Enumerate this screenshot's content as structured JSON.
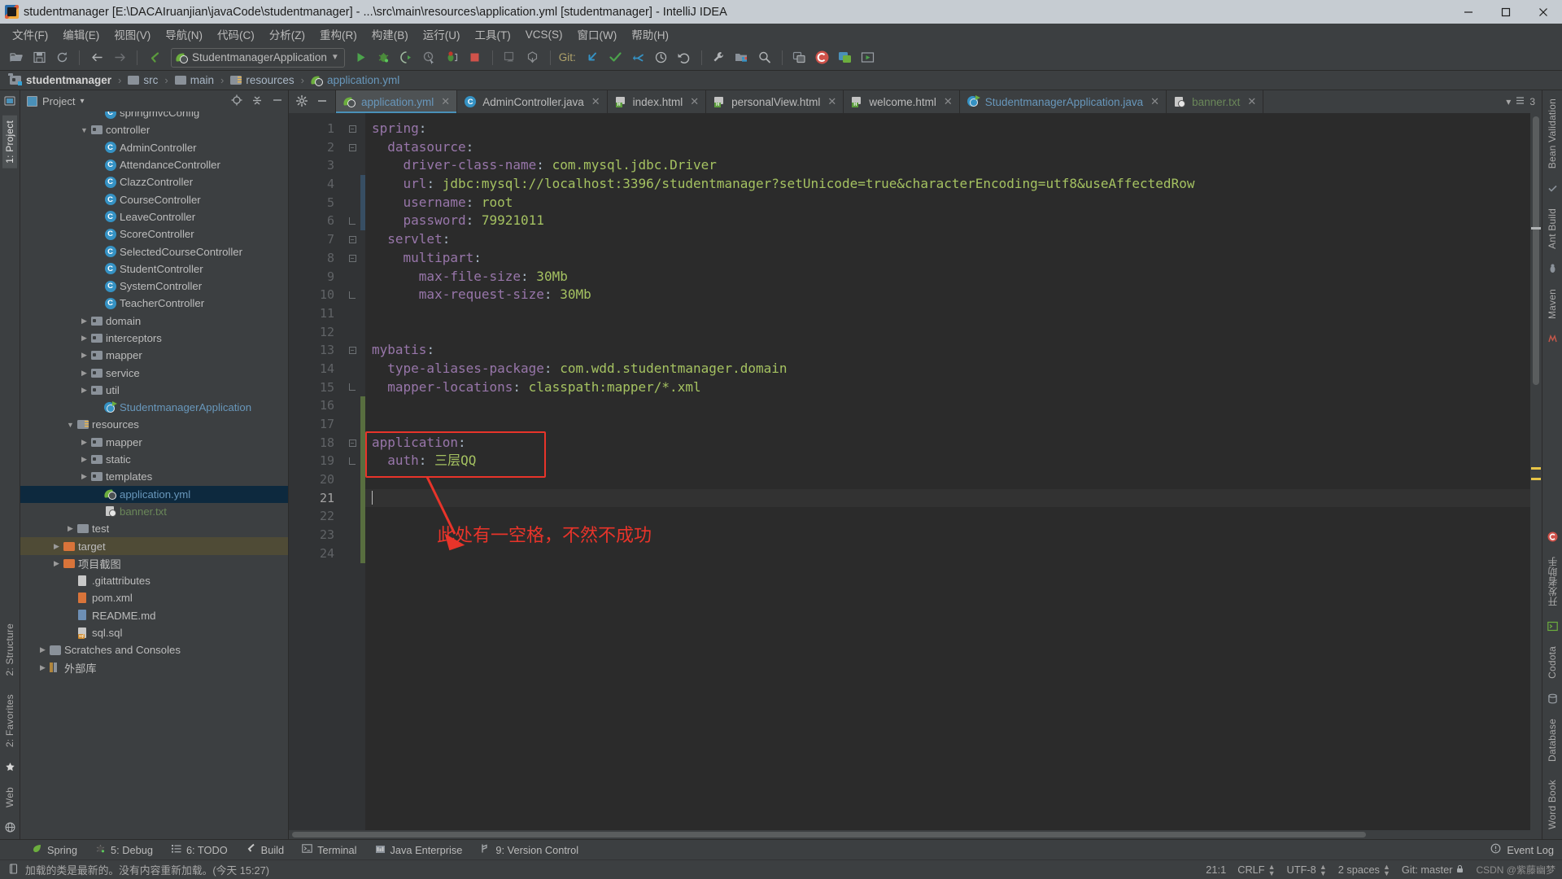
{
  "window": {
    "title": "studentmanager [E:\\DACAIruanjian\\javaCode\\studentmanager] - ...\\src\\main\\resources\\application.yml [studentmanager] - IntelliJ IDEA",
    "minimize": "—",
    "maximize": "▢",
    "close": "✕"
  },
  "menubar": {
    "items": [
      {
        "label": "文件(F)"
      },
      {
        "label": "编辑(E)"
      },
      {
        "label": "视图(V)"
      },
      {
        "label": "导航(N)"
      },
      {
        "label": "代码(C)"
      },
      {
        "label": "分析(Z)"
      },
      {
        "label": "重构(R)"
      },
      {
        "label": "构建(B)"
      },
      {
        "label": "运行(U)"
      },
      {
        "label": "工具(T)"
      },
      {
        "label": "VCS(S)"
      },
      {
        "label": "窗口(W)"
      },
      {
        "label": "帮助(H)"
      }
    ]
  },
  "toolbar": {
    "open_label": "open-folder",
    "save_label": "save-all",
    "sync_label": "synchronize",
    "back_label": "back",
    "forward_label": "forward",
    "run_configuration": "StudentmanagerApplication",
    "git_label": "Git:",
    "run_label": "Run",
    "debug_label": "Debug",
    "run_with_coverage_label": "Run with Coverage",
    "profile_label": "Profiler",
    "attach_label": "Attach Debugger",
    "stop_label": "Stop"
  },
  "navbar": {
    "crumbs": [
      {
        "label": "studentmanager",
        "kind": "module"
      },
      {
        "label": "src",
        "kind": "folder"
      },
      {
        "label": "main",
        "kind": "folder"
      },
      {
        "label": "resources",
        "kind": "resources"
      },
      {
        "label": "application.yml",
        "kind": "yml"
      }
    ],
    "separator": "›"
  },
  "left_rail": {
    "project_tab": "1: Project",
    "structure_tab": "2: Structure",
    "favorites_tab": "2: Favorites",
    "web_tab": "Web"
  },
  "right_rail": {
    "bean_validation_tab": "Bean Validation",
    "ant_build_tab": "Ant Build",
    "maven_tab": "Maven",
    "codota_tab": "Codota",
    "database_tab": "Database",
    "word_book_tab": "Word Book",
    "chinese_tab": "开发者助手"
  },
  "project_panel": {
    "title": "Project",
    "dropdown": "▾",
    "locate_icon": "crosshair-icon",
    "collapse_icon": "collapse-all-icon",
    "hide_icon": "hide-icon",
    "tree": [
      {
        "label": "springmvcConfig",
        "indent": 5,
        "icon": "class",
        "color": "white",
        "arrow": "",
        "partial": true
      },
      {
        "label": "controller",
        "indent": 4,
        "icon": "folder",
        "color": "white",
        "arrow": "▼"
      },
      {
        "label": "AdminController",
        "indent": 5,
        "icon": "class",
        "color": "white",
        "arrow": ""
      },
      {
        "label": "AttendanceController",
        "indent": 5,
        "icon": "class",
        "color": "white",
        "arrow": ""
      },
      {
        "label": "ClazzController",
        "indent": 5,
        "icon": "class",
        "color": "white",
        "arrow": ""
      },
      {
        "label": "CourseController",
        "indent": 5,
        "icon": "class",
        "color": "white",
        "arrow": ""
      },
      {
        "label": "LeaveController",
        "indent": 5,
        "icon": "class",
        "color": "white",
        "arrow": ""
      },
      {
        "label": "ScoreController",
        "indent": 5,
        "icon": "class",
        "color": "white",
        "arrow": ""
      },
      {
        "label": "SelectedCourseController",
        "indent": 5,
        "icon": "class",
        "color": "white",
        "arrow": ""
      },
      {
        "label": "StudentController",
        "indent": 5,
        "icon": "class",
        "color": "white",
        "arrow": ""
      },
      {
        "label": "SystemController",
        "indent": 5,
        "icon": "class",
        "color": "white",
        "arrow": ""
      },
      {
        "label": "TeacherController",
        "indent": 5,
        "icon": "class",
        "color": "white",
        "arrow": ""
      },
      {
        "label": "domain",
        "indent": 4,
        "icon": "folder",
        "color": "white",
        "arrow": "▶"
      },
      {
        "label": "interceptors",
        "indent": 4,
        "icon": "folder",
        "color": "white",
        "arrow": "▶"
      },
      {
        "label": "mapper",
        "indent": 4,
        "icon": "folder",
        "color": "white",
        "arrow": "▶"
      },
      {
        "label": "service",
        "indent": 4,
        "icon": "folder",
        "color": "white",
        "arrow": "▶"
      },
      {
        "label": "util",
        "indent": 4,
        "icon": "folder",
        "color": "white",
        "arrow": "▶"
      },
      {
        "label": "StudentmanagerApplication",
        "indent": 5,
        "icon": "spring",
        "color": "blue",
        "arrow": ""
      },
      {
        "label": "resources",
        "indent": 3,
        "icon": "resources",
        "color": "white",
        "arrow": "▼"
      },
      {
        "label": "mapper",
        "indent": 4,
        "icon": "folder",
        "color": "white",
        "arrow": "▶"
      },
      {
        "label": "static",
        "indent": 4,
        "icon": "folder",
        "color": "white",
        "arrow": "▶"
      },
      {
        "label": "templates",
        "indent": 4,
        "icon": "folder",
        "color": "white",
        "arrow": "▶"
      },
      {
        "label": "application.yml",
        "indent": 5,
        "icon": "yml",
        "color": "blue",
        "arrow": "",
        "selected": true
      },
      {
        "label": "banner.txt",
        "indent": 5,
        "icon": "banner",
        "color": "green",
        "arrow": ""
      },
      {
        "label": "test",
        "indent": 3,
        "icon": "folder-plain",
        "color": "white",
        "arrow": "▶"
      },
      {
        "label": "target",
        "indent": 2,
        "icon": "folder-orange",
        "color": "white",
        "arrow": "▶",
        "highlight": true
      },
      {
        "label": "项目截图",
        "indent": 2,
        "icon": "folder-orange",
        "color": "white",
        "arrow": "▶"
      },
      {
        "label": ".gitattributes",
        "indent": 3,
        "icon": "git",
        "color": "white",
        "arrow": ""
      },
      {
        "label": "pom.xml",
        "indent": 3,
        "icon": "xml",
        "color": "white",
        "arrow": ""
      },
      {
        "label": "README.md",
        "indent": 3,
        "icon": "md",
        "color": "white",
        "arrow": ""
      },
      {
        "label": "sql.sql",
        "indent": 3,
        "icon": "sql",
        "color": "white",
        "arrow": ""
      },
      {
        "label": "Scratches and Consoles",
        "indent": 1,
        "icon": "console",
        "color": "white",
        "arrow": "▶"
      },
      {
        "label": "外部库",
        "indent": 1,
        "icon": "lib",
        "color": "white",
        "arrow": "▶"
      }
    ]
  },
  "editor": {
    "tab_settings_icon": "gear-icon",
    "tab_hide_icon": "minimize-icon",
    "tabs": [
      {
        "label": "application.yml",
        "icon": "yml",
        "color": "blue",
        "active": true,
        "close": "✕"
      },
      {
        "label": "AdminController.java",
        "icon": "class",
        "color": "plain",
        "active": false,
        "close": "✕"
      },
      {
        "label": "index.html",
        "icon": "html",
        "color": "plain",
        "active": false,
        "close": "✕"
      },
      {
        "label": "personalView.html",
        "icon": "html",
        "color": "plain",
        "active": false,
        "close": "✕"
      },
      {
        "label": "welcome.html",
        "icon": "html",
        "color": "plain",
        "active": false,
        "close": "✕"
      },
      {
        "label": "StudentmanagerApplication.java",
        "icon": "spring",
        "color": "blue",
        "active": false,
        "close": "✕"
      },
      {
        "label": "banner.txt",
        "icon": "banner",
        "color": "green",
        "active": false,
        "close": "✕"
      }
    ],
    "tabs_overflow": "▾",
    "tabs_count": "3",
    "line_numbers": [
      "1",
      "2",
      "3",
      "4",
      "5",
      "6",
      "7",
      "8",
      "9",
      "10",
      "11",
      "12",
      "13",
      "14",
      "15",
      "16",
      "17",
      "18",
      "19",
      "20",
      "21",
      "22",
      "23",
      "24"
    ],
    "current_line": 21,
    "lines": [
      {
        "n": 1,
        "indent": 0,
        "key": "spring",
        "colon": ":",
        "value": ""
      },
      {
        "n": 2,
        "indent": 2,
        "key": "datasource",
        "colon": ":",
        "value": ""
      },
      {
        "n": 3,
        "indent": 4,
        "key": "driver-class-name",
        "colon": ":",
        "value": " com.mysql.jdbc.Driver"
      },
      {
        "n": 4,
        "indent": 4,
        "key": "url",
        "colon": ":",
        "value": " jdbc:mysql://localhost:3396/studentmanager?setUnicode=true&characterEncoding=utf8&useAffectedRow"
      },
      {
        "n": 5,
        "indent": 4,
        "key": "username",
        "colon": ":",
        "value": " root"
      },
      {
        "n": 6,
        "indent": 4,
        "key": "password",
        "colon": ":",
        "value": " 79921011"
      },
      {
        "n": 7,
        "indent": 2,
        "key": "servlet",
        "colon": ":",
        "value": ""
      },
      {
        "n": 8,
        "indent": 4,
        "key": "multipart",
        "colon": ":",
        "value": ""
      },
      {
        "n": 9,
        "indent": 6,
        "key": "max-file-size",
        "colon": ":",
        "value": " 30Mb"
      },
      {
        "n": 10,
        "indent": 6,
        "key": "max-request-size",
        "colon": ":",
        "value": " 30Mb"
      },
      {
        "n": 11,
        "indent": 0,
        "key": "",
        "colon": "",
        "value": ""
      },
      {
        "n": 12,
        "indent": 0,
        "key": "",
        "colon": "",
        "value": ""
      },
      {
        "n": 13,
        "indent": 0,
        "key": "mybatis",
        "colon": ":",
        "value": ""
      },
      {
        "n": 14,
        "indent": 2,
        "key": "type-aliases-package",
        "colon": ":",
        "value": " com.wdd.studentmanager.domain"
      },
      {
        "n": 15,
        "indent": 2,
        "key": "mapper-locations",
        "colon": ":",
        "value": " classpath:mapper/*.xml"
      },
      {
        "n": 16,
        "indent": 0,
        "key": "",
        "colon": "",
        "value": ""
      },
      {
        "n": 17,
        "indent": 0,
        "key": "",
        "colon": "",
        "value": ""
      },
      {
        "n": 18,
        "indent": 0,
        "key": "application",
        "colon": ":",
        "value": ""
      },
      {
        "n": 19,
        "indent": 2,
        "key": "auth",
        "colon": ":",
        "value": " 三层QQ"
      },
      {
        "n": 20,
        "indent": 0,
        "key": "",
        "colon": "",
        "value": ""
      },
      {
        "n": 21,
        "indent": 0,
        "key": "",
        "colon": "",
        "value": "",
        "caret": true
      },
      {
        "n": 22,
        "indent": 0,
        "key": "",
        "colon": "",
        "value": ""
      },
      {
        "n": 23,
        "indent": 0,
        "key": "",
        "colon": "",
        "value": ""
      },
      {
        "n": 24,
        "indent": 0,
        "key": "",
        "colon": "",
        "value": ""
      }
    ],
    "annotation": {
      "note": "此处有一空格，不然不成功",
      "color": "#e8342a"
    }
  },
  "bottom_tool_window": {
    "items": [
      {
        "label": "Spring",
        "icon": "leaf-icon",
        "num": ""
      },
      {
        "label": "5: Debug",
        "icon": "bug-icon",
        "num": "5"
      },
      {
        "label": "6: TODO",
        "icon": "list-icon",
        "num": "6"
      },
      {
        "label": "Build",
        "icon": "hammer-icon",
        "num": ""
      },
      {
        "label": "Terminal",
        "icon": "terminal-icon",
        "num": ""
      },
      {
        "label": "Java Enterprise",
        "icon": "java-enterprise-icon",
        "num": ""
      },
      {
        "label": "9: Version Control",
        "icon": "branch-icon",
        "num": "9"
      }
    ],
    "event_log": "Event Log"
  },
  "statusbar": {
    "message": "加载的类是最新的。没有内容重新加载。(今天 15:27)",
    "caret_position": "21:1",
    "line_separator": "CRLF",
    "encoding": "UTF-8",
    "indent": "2 spaces",
    "git_branch": "Git: master",
    "lock_icon": "lock-icon",
    "watermark": "CSDN @紫藤幽梦"
  },
  "colors": {
    "accent": "#4a90b8",
    "annotation_red": "#e8342a",
    "titlebar_bg": "#c6ccd2",
    "panel_bg": "#3c3f41",
    "editor_bg": "#2b2b2b",
    "selection_bg": "#0d293e",
    "string_green": "#a5c261",
    "keyword_purple": "#9876aa",
    "number_blue": "#6897bb"
  }
}
